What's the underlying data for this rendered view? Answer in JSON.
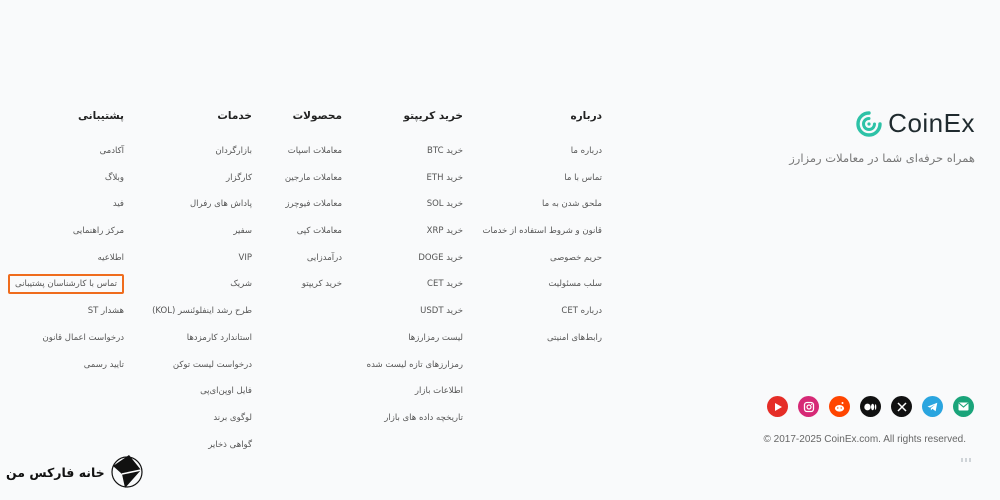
{
  "brand": {
    "name": "CoinEx",
    "tagline": "همراه حرفه‌ای شما در معاملات رمزارز",
    "accent": "#2dc2a7"
  },
  "columns": [
    {
      "title": "درباره",
      "items": [
        "درباره ما",
        "تماس با ما",
        "ملحق شدن به ما",
        "قانون و شروط استفاده از خدمات",
        "حریم خصوصی",
        "سلب مسئولیت",
        "درباره CET",
        "رابط‌های امنیتی"
      ]
    },
    {
      "title": "خرید کریپتو",
      "items": [
        "خرید BTC",
        "خرید ETH",
        "خرید SOL",
        "خرید XRP",
        "خرید DOGE",
        "خرید CET",
        "خرید USDT",
        "لیست رمزارزها",
        "رمزارزهای تازه لیست شده",
        "اطلاعات بازار",
        "تاریخچه داده های بازار"
      ]
    },
    {
      "title": "محصولات",
      "items": [
        "معاملات اسپات",
        "معاملات مارجین",
        "معاملات فیوچرز",
        "معاملات کپی",
        "درآمدزایی",
        "خرید کریپتو"
      ]
    },
    {
      "title": "خدمات",
      "items": [
        "بازارگردان",
        "کارگزار",
        "پاداش های رفرال",
        "سفیر",
        "VIP",
        "شریک",
        "طرح رشد اینفلوئنسر (KOL)",
        "استاندارد کارمزدها",
        "درخواست لیست توکن",
        "فایل اوپن‌ای‌پی",
        "لوگوی برند",
        "گواهی ذخایر"
      ]
    },
    {
      "title": "پشتیبانی",
      "items": [
        "آکادمی",
        "وبلاگ",
        "فید",
        "مرکز راهنمایی",
        "اطلاعیه",
        "تماس با کارشناسان پشتیبانی",
        "هشدار ST",
        "درخواست اعمال قانون",
        "تایید رسمی"
      ]
    }
  ],
  "social": [
    {
      "icon": "email-icon",
      "color": "#1aa47a",
      "glyph": "✉"
    },
    {
      "icon": "telegram-icon",
      "color": "#2aa5df",
      "glyph": "➤"
    },
    {
      "icon": "x-icon",
      "color": "#111111",
      "glyph": "𝕏"
    },
    {
      "icon": "medium-icon",
      "color": "#111111",
      "glyph": "●●"
    },
    {
      "icon": "reddit-icon",
      "color": "#ff4500",
      "glyph": "◉"
    },
    {
      "icon": "instagram-icon",
      "color": "#d62976",
      "glyph": "◎"
    },
    {
      "icon": "youtube-icon",
      "color": "#e52d27",
      "glyph": "▶"
    }
  ],
  "copyright": "© 2017-2025 CoinEx.com. All rights reserved.",
  "watermark": "خانه فارکس من",
  "highlight_color": "#ef6c1d"
}
